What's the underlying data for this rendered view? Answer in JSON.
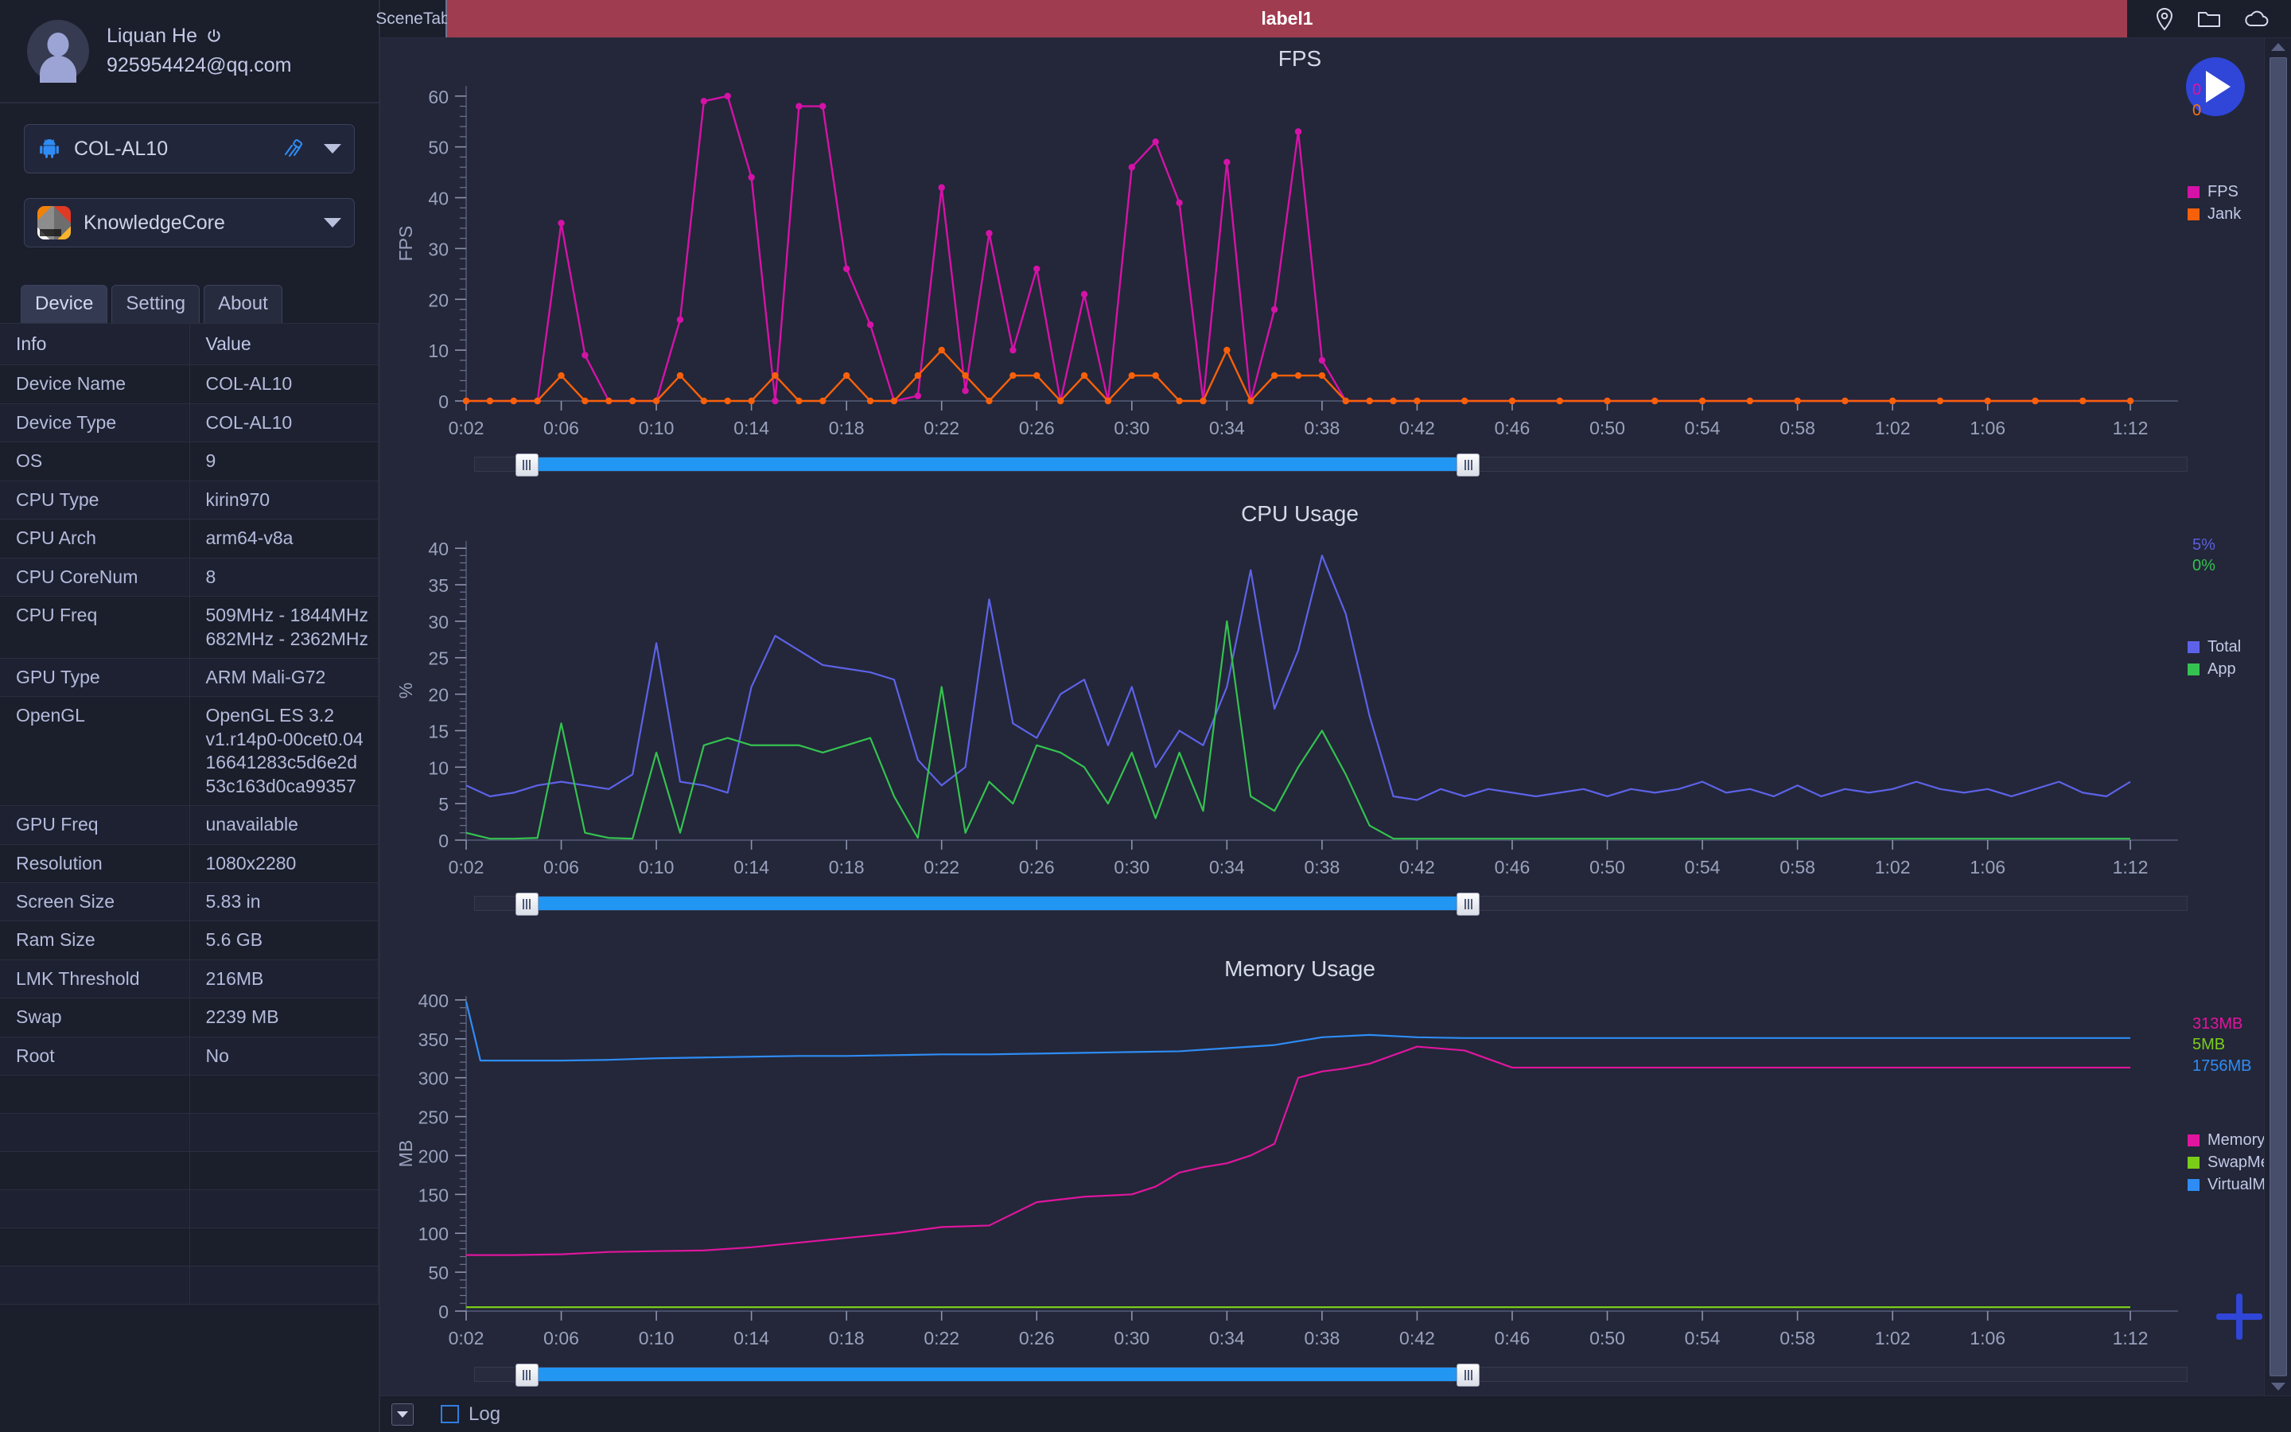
{
  "sidebar": {
    "profile": {
      "name": "Liquan He",
      "email": "925954424@qq.com",
      "power_icon": "power-icon"
    },
    "device_select": {
      "label": "COL-AL10",
      "icon": "android-icon",
      "link_icon": "link-icon"
    },
    "app_select": {
      "label": "KnowledgeCore",
      "icon": "app-icon"
    },
    "tabs": [
      {
        "label": "Device",
        "active": true
      },
      {
        "label": "Setting",
        "active": false
      },
      {
        "label": "About",
        "active": false
      }
    ],
    "table": {
      "headers": [
        "Info",
        "Value"
      ],
      "rows": [
        {
          "info": "Device Name",
          "value": "COL-AL10"
        },
        {
          "info": "Device Type",
          "value": "COL-AL10"
        },
        {
          "info": "OS",
          "value": "9"
        },
        {
          "info": "CPU Type",
          "value": "kirin970"
        },
        {
          "info": "CPU Arch",
          "value": "arm64-v8a"
        },
        {
          "info": "CPU CoreNum",
          "value": "8"
        },
        {
          "info": "CPU Freq",
          "value": "509MHz - 1844MHz\n682MHz - 2362MHz"
        },
        {
          "info": "GPU Type",
          "value": "ARM Mali-G72"
        },
        {
          "info": "OpenGL",
          "value": "OpenGL ES 3.2\nv1.r14p0-00cet0.04\n16641283c5d6e2d\n53c163d0ca99357"
        },
        {
          "info": "GPU Freq",
          "value": "unavailable"
        },
        {
          "info": "Resolution",
          "value": "1080x2280"
        },
        {
          "info": "Screen Size",
          "value": "5.83 in"
        },
        {
          "info": "Ram Size",
          "value": "5.6 GB"
        },
        {
          "info": "LMK Threshold",
          "value": "216MB"
        },
        {
          "info": "Swap",
          "value": "2239 MB"
        },
        {
          "info": "Root",
          "value": "No"
        }
      ]
    }
  },
  "topbar": {
    "scene_tab": "SceneTab",
    "label": "label1",
    "label_color": "#a03c50",
    "icons": [
      "location-pin-icon",
      "folder-icon",
      "cloud-icon"
    ]
  },
  "controls": {
    "play_label": "play-button",
    "add_label": "add-button"
  },
  "bottombar": {
    "log_label": "Log",
    "log_checked": false,
    "dropdown_icon": "chevron-down-icon"
  },
  "xaxis_ticks": [
    "0:02",
    "0:06",
    "0:10",
    "0:14",
    "0:18",
    "0:22",
    "0:26",
    "0:30",
    "0:34",
    "0:38",
    "0:42",
    "0:46",
    "0:50",
    "0:54",
    "0:58",
    "1:02",
    "1:06",
    "1:12"
  ],
  "chart_data": [
    {
      "type": "line",
      "title": "FPS",
      "xlabel": "",
      "ylabel": "FPS",
      "ylim": [
        0,
        62
      ],
      "yticks": [
        0,
        10,
        20,
        30,
        40,
        50,
        60
      ],
      "xlim": [
        2,
        72
      ],
      "xtick_labels": [
        "0:02",
        "0:06",
        "0:10",
        "0:14",
        "0:18",
        "0:22",
        "0:26",
        "0:30",
        "0:34",
        "0:38",
        "0:42",
        "0:46",
        "0:50",
        "0:54",
        "0:58",
        "1:02",
        "1:06",
        "1:12"
      ],
      "grid": false,
      "legend_position": "right",
      "current_values": [
        {
          "label": "0",
          "color": "#e0159e"
        },
        {
          "label": "0",
          "color": "#f77216"
        }
      ],
      "series": [
        {
          "name": "FPS",
          "color": "#d512a8",
          "markers": true,
          "x": [
            2,
            3,
            4,
            5,
            6,
            7,
            8,
            9,
            10,
            11,
            12,
            13,
            14,
            15,
            16,
            17,
            18,
            19,
            20,
            21,
            22,
            23,
            24,
            25,
            26,
            27,
            28,
            29,
            30,
            31,
            32,
            33,
            34,
            35,
            36,
            37,
            38,
            39,
            40,
            41,
            42,
            44,
            46,
            48,
            50,
            52,
            54,
            56,
            58,
            60,
            62,
            64,
            66,
            68,
            70,
            72
          ],
          "values": [
            0,
            0,
            0,
            0,
            35,
            9,
            0,
            0,
            0,
            16,
            59,
            60,
            44,
            0,
            58,
            58,
            26,
            15,
            0,
            1,
            42,
            2,
            33,
            10,
            26,
            0,
            21,
            0,
            46,
            51,
            39,
            0,
            47,
            0,
            18,
            53,
            8,
            0,
            0,
            0,
            0,
            0,
            0,
            0,
            0,
            0,
            0,
            0,
            0,
            0,
            0,
            0,
            0,
            0,
            0,
            0
          ]
        },
        {
          "name": "Jank",
          "color": "#f8600a",
          "markers": true,
          "x": [
            2,
            3,
            4,
            5,
            6,
            7,
            8,
            9,
            10,
            11,
            12,
            13,
            14,
            15,
            16,
            17,
            18,
            19,
            20,
            21,
            22,
            23,
            24,
            25,
            26,
            27,
            28,
            29,
            30,
            31,
            32,
            33,
            34,
            35,
            36,
            37,
            38,
            39,
            40,
            41,
            42,
            44,
            46,
            48,
            50,
            52,
            54,
            56,
            58,
            60,
            62,
            64,
            66,
            68,
            70,
            72
          ],
          "values": [
            0,
            0,
            0,
            0,
            5,
            0,
            0,
            0,
            0,
            5,
            0,
            0,
            0,
            5,
            0,
            0,
            5,
            0,
            0,
            5,
            10,
            5,
            0,
            5,
            5,
            0,
            5,
            0,
            5,
            5,
            0,
            0,
            10,
            0,
            5,
            5,
            5,
            0,
            0,
            0,
            0,
            0,
            0,
            0,
            0,
            0,
            0,
            0,
            0,
            0,
            0,
            0,
            0,
            0,
            0,
            0
          ]
        }
      ],
      "slider": {
        "start_pct": 3,
        "end_pct": 58
      }
    },
    {
      "type": "line",
      "title": "CPU Usage",
      "xlabel": "",
      "ylabel": "%",
      "ylim": [
        0,
        41
      ],
      "yticks": [
        0,
        5,
        10,
        15,
        20,
        25,
        30,
        35,
        40
      ],
      "xlim": [
        2,
        72
      ],
      "xtick_labels": [
        "0:02",
        "0:06",
        "0:10",
        "0:14",
        "0:18",
        "0:22",
        "0:26",
        "0:30",
        "0:34",
        "0:38",
        "0:42",
        "0:46",
        "0:50",
        "0:54",
        "0:58",
        "1:02",
        "1:06",
        "1:12"
      ],
      "grid": false,
      "legend_position": "right",
      "current_values": [
        {
          "label": "5%",
          "color": "#5a5fe0"
        },
        {
          "label": "0%",
          "color": "#33c24d"
        }
      ],
      "series": [
        {
          "name": "Total",
          "color": "#5d62e8",
          "markers": false,
          "x": [
            2,
            3,
            4,
            5,
            6,
            7,
            8,
            9,
            10,
            11,
            12,
            13,
            14,
            15,
            16,
            17,
            18,
            19,
            20,
            21,
            22,
            23,
            24,
            25,
            26,
            27,
            28,
            29,
            30,
            31,
            32,
            33,
            34,
            35,
            36,
            37,
            38,
            39,
            40,
            41,
            42,
            43,
            44,
            45,
            46,
            47,
            48,
            49,
            50,
            51,
            52,
            53,
            54,
            55,
            56,
            57,
            58,
            59,
            60,
            61,
            62,
            63,
            64,
            65,
            66,
            67,
            68,
            69,
            70,
            71,
            72
          ],
          "values": [
            7.5,
            6,
            6.5,
            7.5,
            8,
            7.5,
            7,
            9,
            27,
            8,
            7.5,
            6.5,
            21,
            28,
            26,
            24,
            23.5,
            23,
            22,
            11,
            7.5,
            10,
            33,
            16,
            14,
            20,
            22,
            13,
            21,
            10,
            15,
            13,
            21,
            37,
            18,
            26,
            39,
            31,
            17,
            6,
            5.5,
            7,
            6,
            7,
            6.5,
            6,
            6.5,
            7,
            6,
            7,
            6.5,
            7,
            8,
            6.5,
            7,
            6,
            7.5,
            6,
            7,
            6.5,
            7,
            8,
            7,
            6.5,
            7,
            6,
            7,
            8,
            6.5,
            6,
            8
          ]
        },
        {
          "name": "App",
          "color": "#35c250",
          "markers": false,
          "x": [
            2,
            3,
            4,
            5,
            6,
            7,
            8,
            9,
            10,
            11,
            12,
            13,
            14,
            15,
            16,
            17,
            18,
            19,
            20,
            21,
            22,
            23,
            24,
            25,
            26,
            27,
            28,
            29,
            30,
            31,
            32,
            33,
            34,
            35,
            36,
            37,
            38,
            39,
            40,
            41,
            42,
            43,
            44,
            45,
            46,
            47,
            48,
            49,
            50,
            51,
            52,
            53,
            54,
            55,
            56,
            57,
            58,
            59,
            60,
            61,
            62,
            63,
            64,
            65,
            66,
            67,
            68,
            69,
            70,
            71,
            72
          ],
          "values": [
            1,
            0.2,
            0.2,
            0.3,
            16,
            1,
            0.3,
            0.2,
            12,
            1,
            13,
            14,
            13,
            13,
            13,
            12,
            13,
            14,
            6,
            0.3,
            21,
            1,
            8,
            5,
            13,
            12,
            10,
            5,
            12,
            3,
            12,
            4,
            30,
            6,
            4,
            10,
            15,
            9,
            2,
            0.2,
            0.2,
            0.2,
            0.2,
            0.2,
            0.2,
            0.2,
            0.2,
            0.2,
            0.2,
            0.2,
            0.2,
            0.2,
            0.2,
            0.2,
            0.2,
            0.2,
            0.2,
            0.2,
            0.2,
            0.2,
            0.2,
            0.2,
            0.2,
            0.2,
            0.2,
            0.2,
            0.2,
            0.2,
            0.2,
            0.2,
            0.2
          ]
        }
      ],
      "slider": {
        "start_pct": 3,
        "end_pct": 58
      }
    },
    {
      "type": "line",
      "title": "Memory Usage",
      "xlabel": "",
      "ylabel": "MB",
      "ylim": [
        0,
        405
      ],
      "yticks": [
        0,
        50,
        100,
        150,
        200,
        250,
        300,
        350,
        400
      ],
      "xlim": [
        2,
        72
      ],
      "xtick_labels": [
        "0:02",
        "0:06",
        "0:10",
        "0:14",
        "0:18",
        "0:22",
        "0:26",
        "0:30",
        "0:34",
        "0:38",
        "0:42",
        "0:46",
        "0:50",
        "0:54",
        "0:58",
        "1:02",
        "1:06",
        "1:12"
      ],
      "grid": false,
      "legend_position": "right",
      "current_values": [
        {
          "label": "313MB",
          "color": "#e0159e"
        },
        {
          "label": "5MB",
          "color": "#7ace18"
        },
        {
          "label": "1756MB",
          "color": "#2f8cf5"
        }
      ],
      "series": [
        {
          "name": "Memory",
          "color": "#e0159e",
          "markers": false,
          "x": [
            2,
            4,
            6,
            8,
            10,
            12,
            14,
            16,
            18,
            20,
            22,
            24,
            26,
            28,
            30,
            31,
            32,
            33,
            34,
            35,
            36,
            37,
            38,
            39,
            40,
            42,
            44,
            46,
            48,
            50,
            52,
            54,
            56,
            58,
            60,
            62,
            64,
            66,
            68,
            70,
            72
          ],
          "values": [
            72,
            72,
            73,
            76,
            77,
            78,
            82,
            88,
            94,
            100,
            108,
            110,
            140,
            147,
            150,
            160,
            178,
            185,
            190,
            200,
            215,
            300,
            308,
            312,
            318,
            340,
            335,
            313,
            313,
            313,
            313,
            313,
            313,
            313,
            313,
            313,
            313,
            313,
            313,
            313,
            313
          ]
        },
        {
          "name": "SwapMemory",
          "color": "#7ace18",
          "markers": false,
          "x": [
            2,
            10,
            20,
            30,
            40,
            50,
            60,
            72
          ],
          "values": [
            5,
            5,
            5,
            5,
            5,
            5,
            5,
            5
          ]
        },
        {
          "name": "VirtualMemory",
          "color": "#2f8cf5",
          "markers": false,
          "x": [
            2,
            2.6,
            4,
            6,
            8,
            10,
            12,
            14,
            16,
            18,
            20,
            22,
            24,
            26,
            28,
            30,
            32,
            34,
            36,
            38,
            40,
            42,
            44,
            46,
            48,
            50,
            52,
            54,
            56,
            58,
            60,
            62,
            64,
            66,
            68,
            70,
            72
          ],
          "values": [
            398,
            322,
            322,
            322,
            323,
            325,
            326,
            327,
            328,
            328,
            329,
            330,
            330,
            331,
            332,
            333,
            334,
            338,
            342,
            352,
            355,
            352,
            351,
            351,
            351,
            351,
            351,
            351,
            351,
            351,
            351,
            351,
            351,
            351,
            351,
            351,
            351
          ]
        }
      ],
      "slider": {
        "start_pct": 3,
        "end_pct": 58
      }
    }
  ]
}
